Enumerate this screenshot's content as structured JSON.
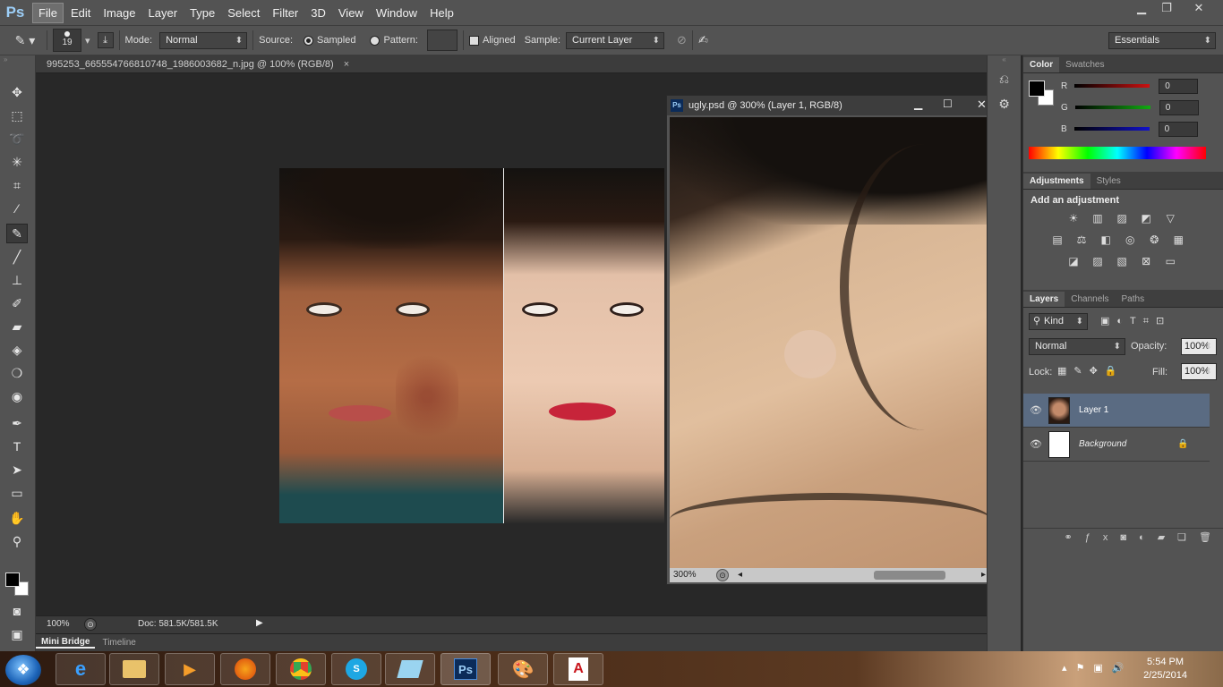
{
  "app": {
    "logo": "Ps"
  },
  "menu": [
    "File",
    "Edit",
    "Image",
    "Layer",
    "Type",
    "Select",
    "Filter",
    "3D",
    "View",
    "Window",
    "Help"
  ],
  "options": {
    "brush_size": "19",
    "mode_label": "Mode:",
    "mode_value": "Normal",
    "source_label": "Source:",
    "sampled_label": "Sampled",
    "pattern_label": "Pattern:",
    "aligned_label": "Aligned",
    "sample_label": "Sample:",
    "sample_value": "Current Layer",
    "workspace": "Essentials"
  },
  "document": {
    "tab_title": "995253_665554766810748_1986003682_n.jpg @ 100% (RGB/8)",
    "zoom": "100%",
    "doc_size": "Doc: 581.5K/581.5K"
  },
  "floating": {
    "title": "ugly.psd @ 300% (Layer 1, RGB/8)",
    "zoom": "300%"
  },
  "bottom_tabs": {
    "mini_bridge": "Mini Bridge",
    "timeline": "Timeline"
  },
  "color_panel": {
    "tabs": [
      "Color",
      "Swatches"
    ],
    "r_label": "R",
    "g_label": "G",
    "b_label": "B",
    "r_value": "0",
    "g_value": "0",
    "b_value": "0",
    "r_color": "#cc1111",
    "g_color": "#11aa11",
    "b_color": "#1111cc"
  },
  "adjustments_panel": {
    "tabs": [
      "Adjustments",
      "Styles"
    ],
    "heading": "Add an adjustment"
  },
  "layers_panel": {
    "tabs": [
      "Layers",
      "Channels",
      "Paths"
    ],
    "kind": "Kind",
    "blend": "Normal",
    "opacity_label": "Opacity:",
    "opacity_value": "100%",
    "lock_label": "Lock:",
    "fill_label": "Fill:",
    "fill_value": "100%",
    "layers": [
      {
        "name": "Layer 1"
      },
      {
        "name": "Background"
      }
    ]
  },
  "taskbar": {
    "time": "5:54 PM",
    "date": "2/25/2014"
  }
}
